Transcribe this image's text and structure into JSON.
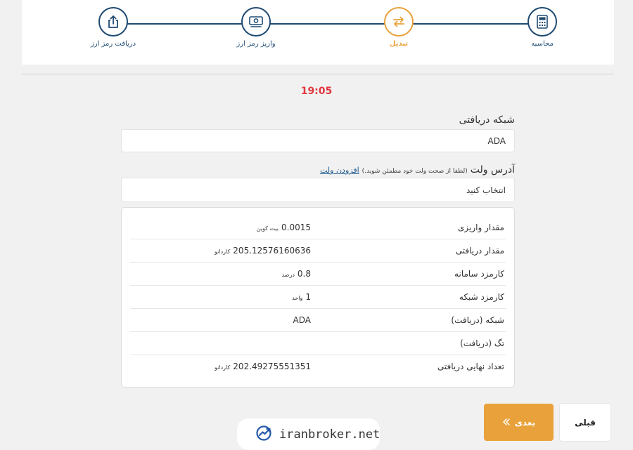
{
  "stepper": {
    "steps": [
      {
        "label": "دریافت رمز ارز",
        "icon": "share-upload-icon",
        "active": false
      },
      {
        "label": "واریز رمز ارز",
        "icon": "money-icon",
        "active": false
      },
      {
        "label": "تبدیل",
        "icon": "exchange-arrows-icon",
        "active": true
      },
      {
        "label": "محاسبه",
        "icon": "calculator-icon",
        "active": false
      }
    ]
  },
  "timer": "19:05",
  "network": {
    "label": "شبکه دریافتی",
    "value": "ADA"
  },
  "wallet": {
    "label": "آدرس ولت",
    "hint": "(لطفا از صحت ولت خود مطمئن شوید.)",
    "add_link": "افزودن ولت",
    "placeholder": "انتخاب کنید"
  },
  "summary": {
    "rows": [
      {
        "label": "مقدار واریزی",
        "value": "0.0015",
        "unit": "بیت کوین"
      },
      {
        "label": "مقدار دریافتی",
        "value": "205.12576160636",
        "unit": "کاردانو"
      },
      {
        "label": "کارمزد سامانه",
        "value": "0.8",
        "unit": "درصد"
      },
      {
        "label": "کارمزد شبکه",
        "value": "1",
        "unit": "واحد"
      },
      {
        "label": "شبکه (دریافت)",
        "value": "ADA",
        "unit": ""
      },
      {
        "label": "تگ (دریافت)",
        "value": "",
        "unit": ""
      },
      {
        "label": "تعداد نهایی دریافتی",
        "value": "202.49275551351",
        "unit": "کاردانو"
      }
    ]
  },
  "buttons": {
    "next_label": "بعدی",
    "prev_label": "قبلی"
  },
  "watermark": {
    "text": "iranbroker.net"
  },
  "colors": {
    "primary": "#1e4a72",
    "accent": "#e9a23b",
    "timer": "#e2373f"
  }
}
